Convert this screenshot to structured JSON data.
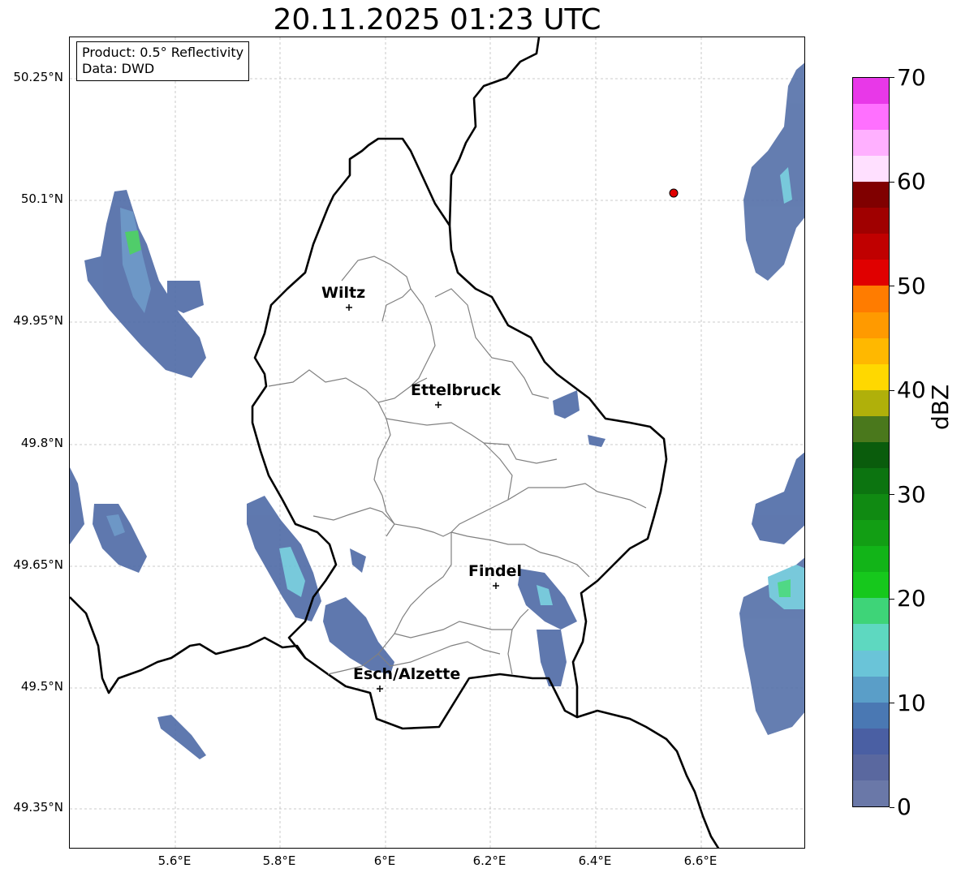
{
  "title": "20.11.2025 01:23 UTC",
  "info": {
    "product": "Product: 0.5° Reflectivity",
    "source": "Data: DWD"
  },
  "lat_ticks": [
    "50.25°N",
    "50.1°N",
    "49.95°N",
    "49.8°N",
    "49.65°N",
    "49.5°N",
    "49.35°N"
  ],
  "lon_ticks": [
    "5.6°E",
    "5.8°E",
    "6°E",
    "6.2°E",
    "6.4°E",
    "6.6°E"
  ],
  "cities": {
    "wiltz": "Wiltz",
    "ettelbruck": "Ettelbruck",
    "findel": "Findel",
    "esch": "Esch/Alzette"
  },
  "colorbar": {
    "label": "dBZ",
    "ticks": [
      "0",
      "10",
      "20",
      "30",
      "40",
      "50",
      "60",
      "70"
    ],
    "colors": [
      "#6a78a8",
      "#5a689f",
      "#4a5fa3",
      "#4a78b3",
      "#5a9ec8",
      "#6ac4d8",
      "#5ed8c0",
      "#3ed478",
      "#16c81c",
      "#12b418",
      "#129e14",
      "#108a12",
      "#0c7410",
      "#0a5c0c",
      "#4a781c",
      "#b0b00a",
      "#ffd800",
      "#ffb800",
      "#ff9a00",
      "#ff7c00",
      "#e00000",
      "#c00000",
      "#a00000",
      "#800000",
      "#ffe0ff",
      "#ffb0ff",
      "#ff70ff",
      "#e838e8"
    ]
  },
  "radar_marker": {
    "lon": 6.55,
    "lat": 50.11,
    "color": "#e00000"
  },
  "colors": {
    "border": "#000000",
    "canton": "#808080",
    "grid": "#bbbbbb"
  }
}
